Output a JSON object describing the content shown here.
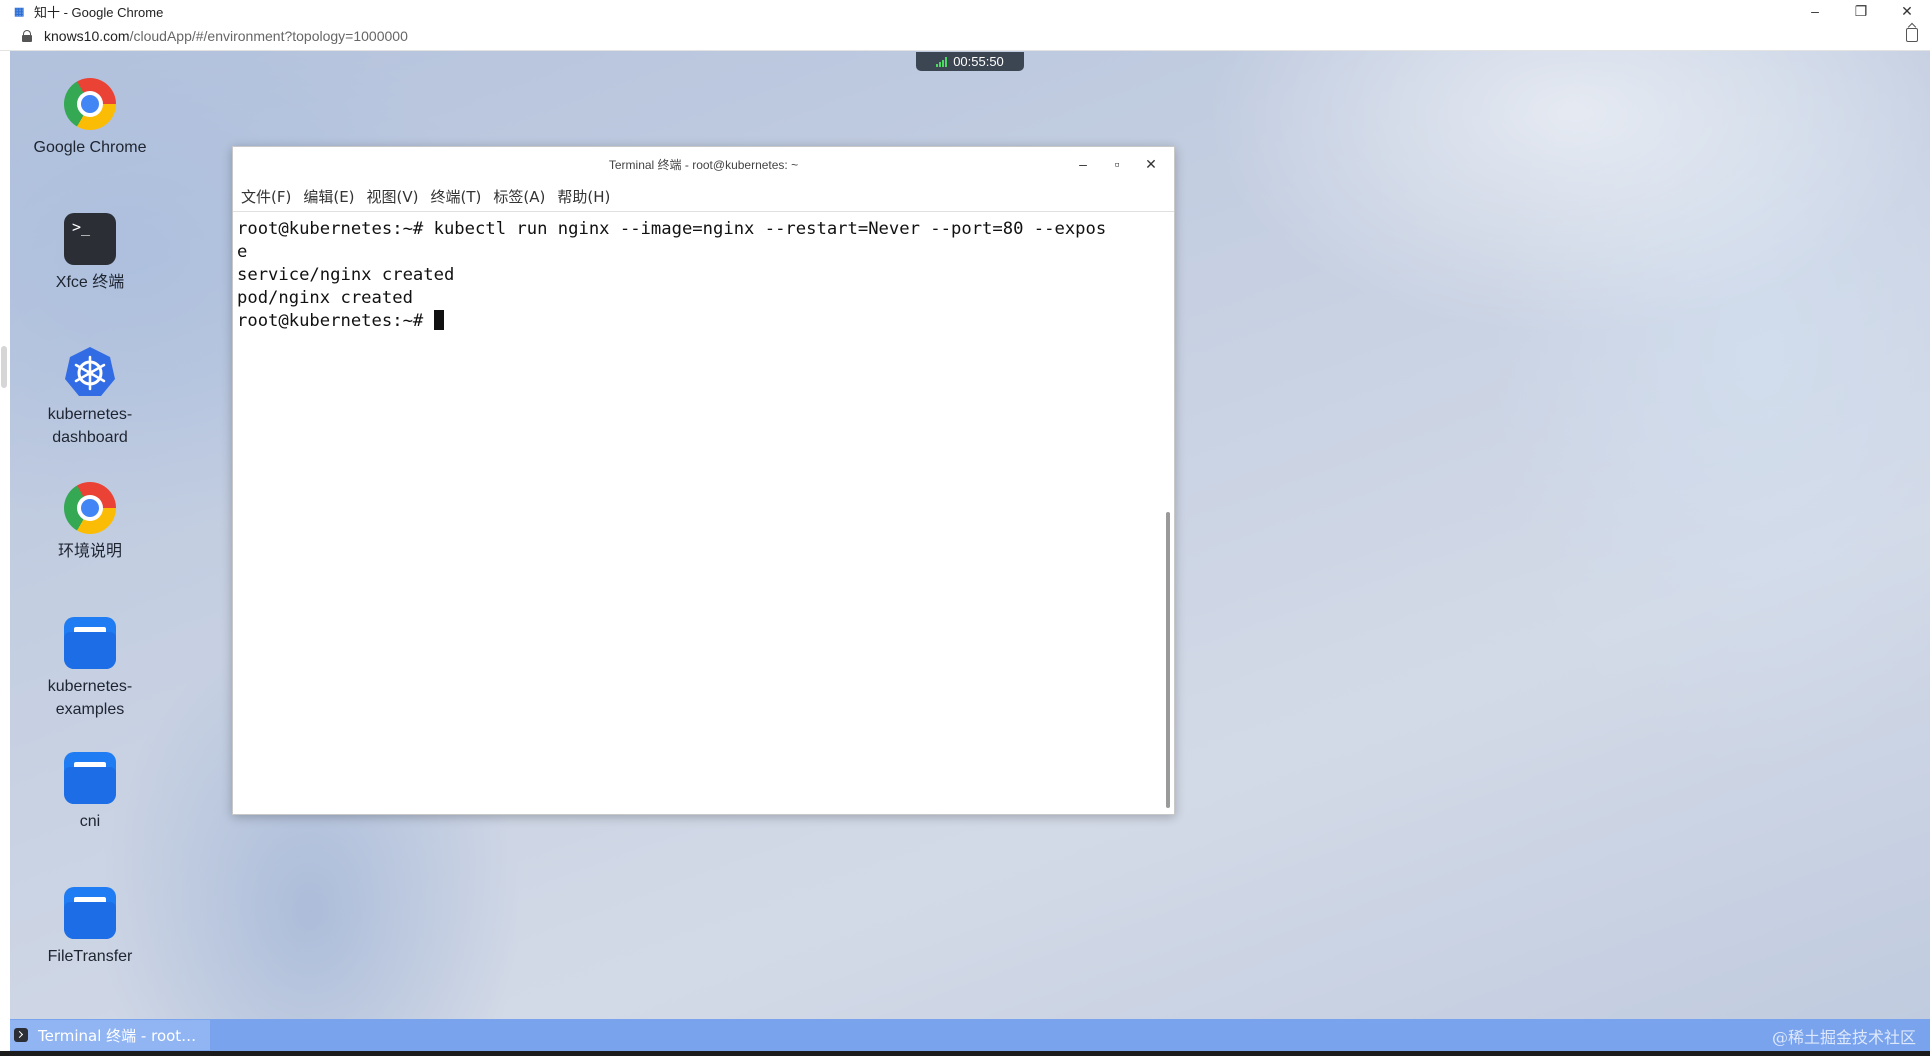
{
  "browser": {
    "window_title": "知十 - Google Chrome",
    "favicon_text": "知十",
    "url_host": "knows10.com",
    "url_path": "/cloudApp/#/environment?topology=1000000"
  },
  "session_timer": "00:55:50",
  "desktop_icons": [
    {
      "label": "Google Chrome",
      "icon": "chrome-icon"
    },
    {
      "label": "Xfce 终端",
      "icon": "terminal-icon"
    },
    {
      "label": "kubernetes-dashboard",
      "label_line1": "kubernetes-",
      "label_line2": "dashboard",
      "icon": "kubernetes-icon"
    },
    {
      "label": "环境说明",
      "icon": "chrome-icon"
    },
    {
      "label": "kubernetes-examples",
      "label_line1": "kubernetes-",
      "label_line2": "examples",
      "icon": "folder-icon"
    },
    {
      "label": "cni",
      "icon": "folder-icon"
    },
    {
      "label": "FileTransfer",
      "icon": "folder-icon"
    }
  ],
  "terminal": {
    "title": "Terminal 终端 - root@kubernetes: ~",
    "menu": [
      "文件(F)",
      "编辑(E)",
      "视图(V)",
      "终端(T)",
      "标签(A)",
      "帮助(H)"
    ],
    "lines": [
      "root@kubernetes:~# kubectl run nginx --image=nginx --restart=Never --port=80 --expos",
      "e",
      "service/nginx created",
      "pod/nginx created"
    ],
    "prompt": "root@kubernetes:~# "
  },
  "taskbar": {
    "active_task": "Terminal 终端 - root…"
  },
  "watermark": "@稀土掘金技术社区",
  "colors": {
    "taskbar": "#7aa3ee",
    "folder": "#1f7cf2",
    "k8s": "#326ce5"
  }
}
